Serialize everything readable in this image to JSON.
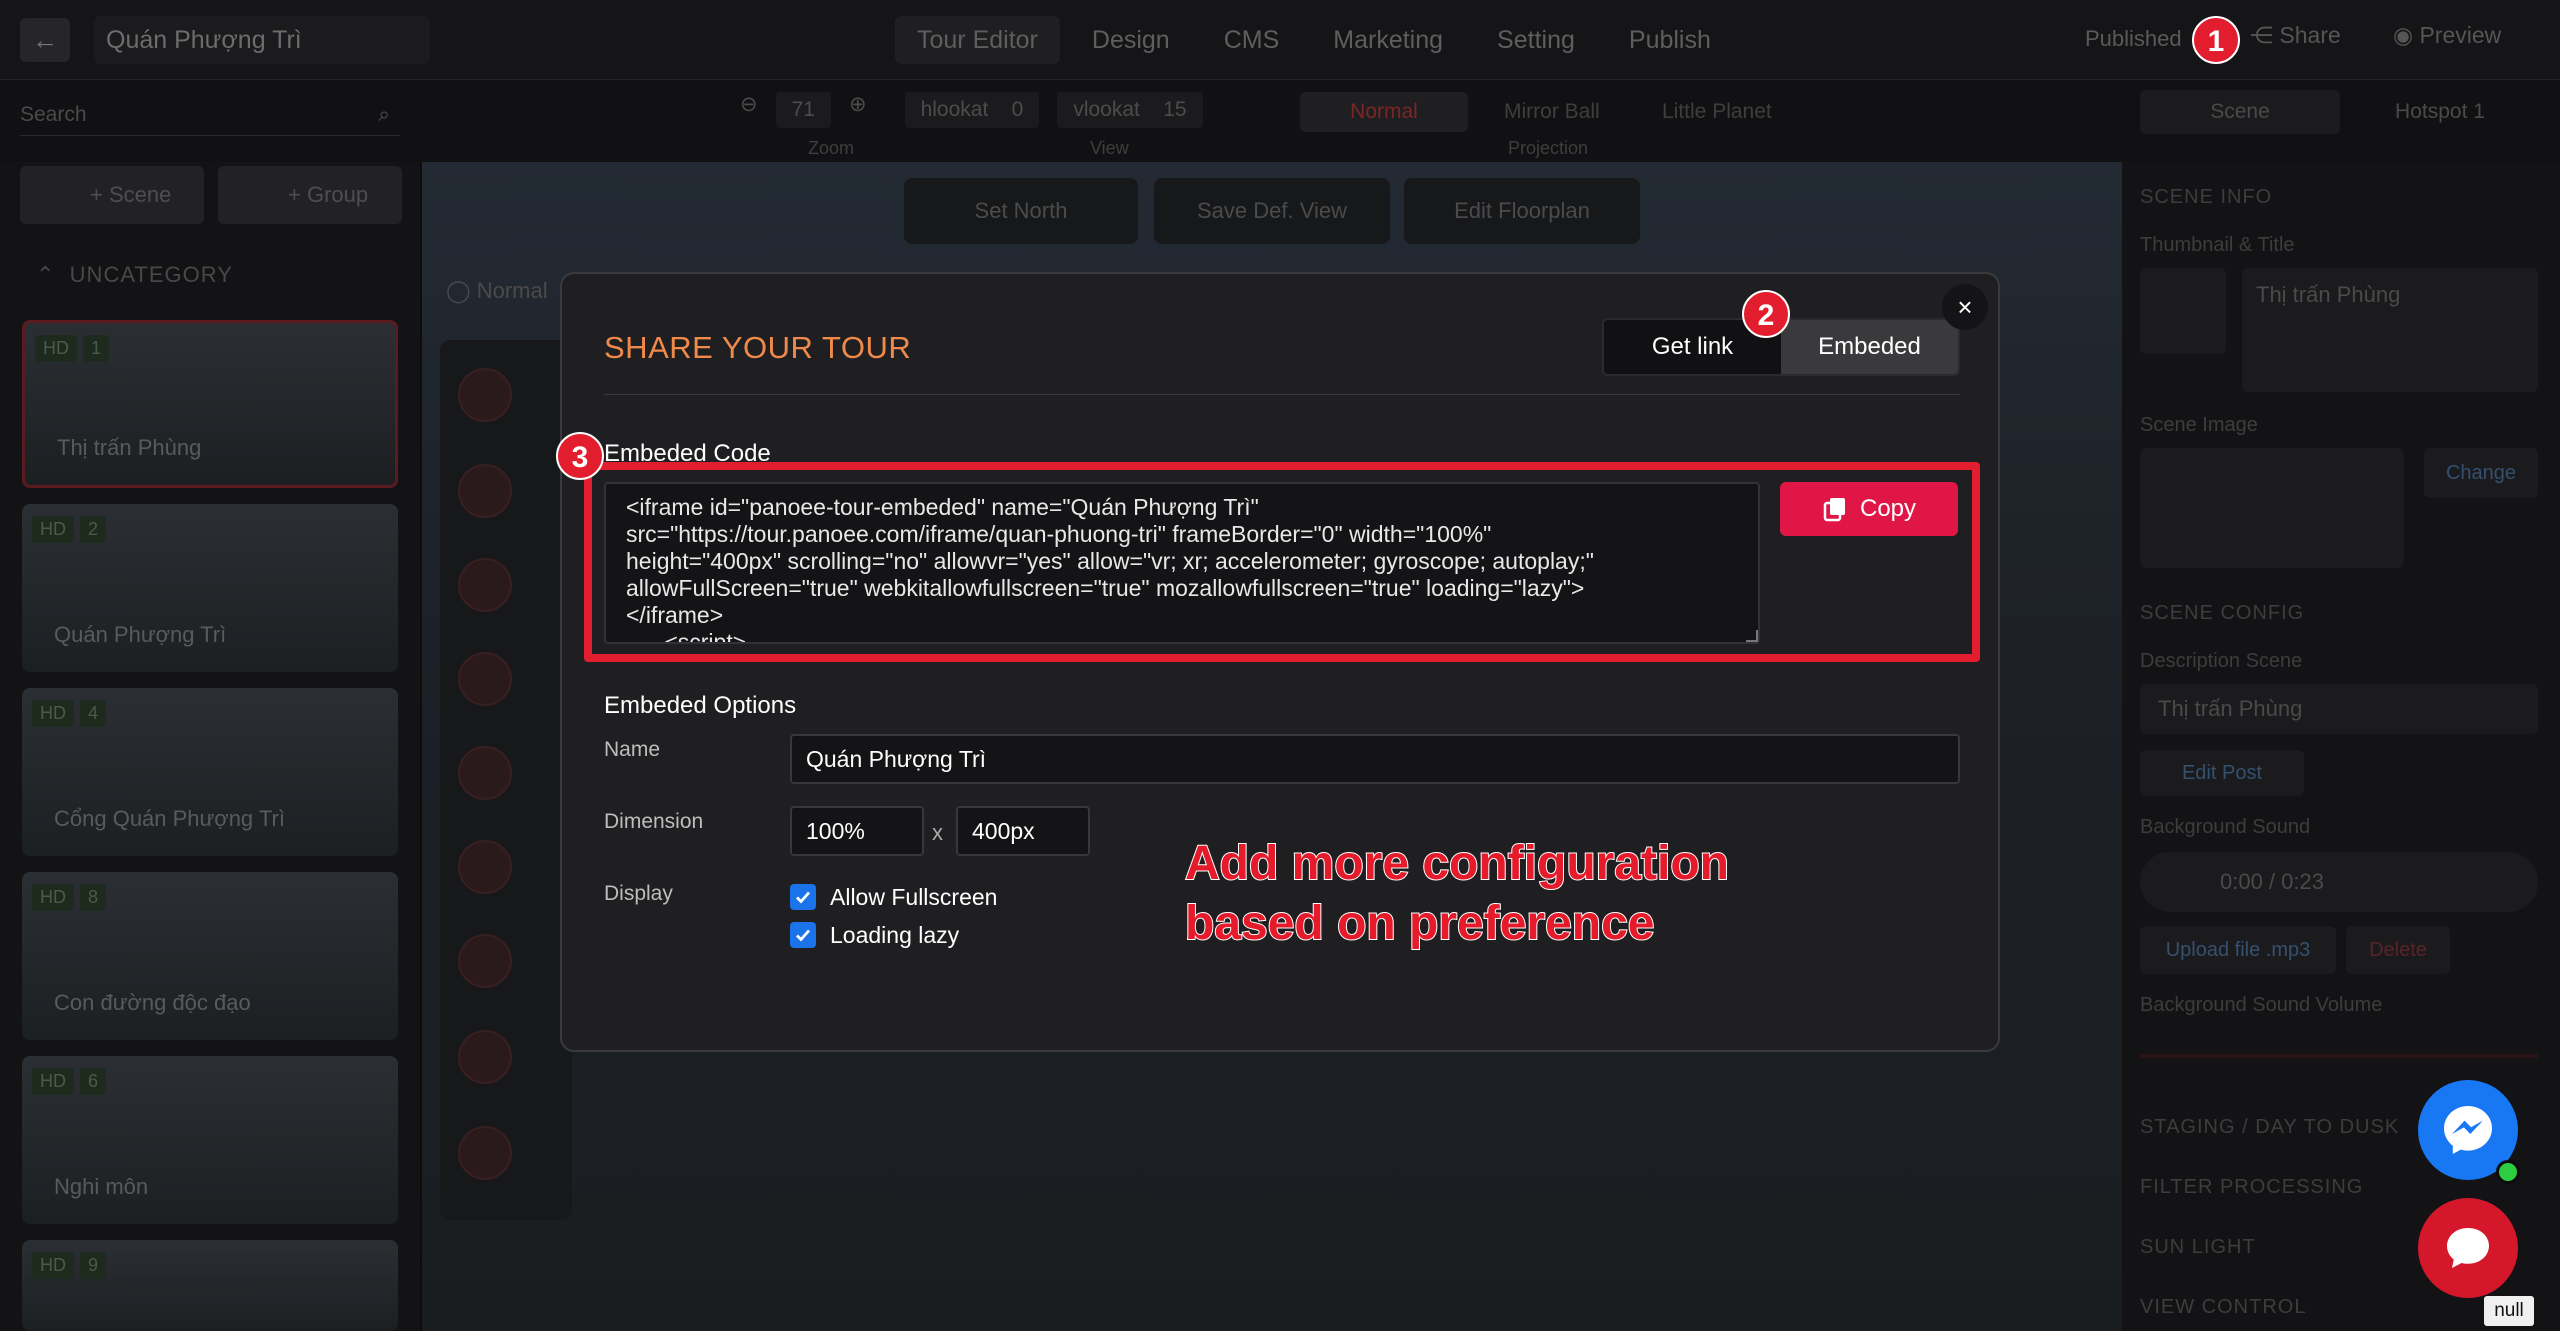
{
  "app": {
    "project_title": "Quán Phượng Trì",
    "nav": [
      "Tour Editor",
      "Design",
      "CMS",
      "Marketing",
      "Setting",
      "Publish"
    ],
    "published_label": "Published",
    "share_label": "Share",
    "preview_label": "Preview",
    "search_placeholder": "Search",
    "zoom_value": "71",
    "zoom_label": "Zoom",
    "hlookat_label": "hlookat",
    "hlookat_value": "0",
    "vlookat_label": "vlookat",
    "vlookat_value": "15",
    "view_label": "View",
    "projection": [
      "Normal",
      "Mirror Ball",
      "Little Planet"
    ],
    "projection_label": "Projection",
    "right_tabs": [
      "Scene",
      "Hotspot"
    ],
    "hotspot_count": "1",
    "add_scene": "+ Scene",
    "add_group": "+ Group",
    "category": "UNCATEGORY",
    "scenes": [
      {
        "name": "Thị trấn Phùng",
        "badge": "HD",
        "num": "1"
      },
      {
        "name": "Quán Phượng Trì",
        "badge": "HD",
        "num": "2"
      },
      {
        "name": "Cổng Quán Phượng Trì",
        "badge": "HD",
        "num": "4"
      },
      {
        "name": "Con đường độc đạo",
        "badge": "HD",
        "num": "8"
      },
      {
        "name": "Nghi môn",
        "badge": "HD",
        "num": "6"
      },
      {
        "name": "",
        "badge": "HD",
        "num": "9"
      }
    ],
    "canvas_buttons": [
      "Set North",
      "Save Def. View",
      "Edit Floorplan"
    ],
    "canvas_mode": "Normal",
    "right_panel": {
      "scene_info": "SCENE INFO",
      "thumb_title": "Thumbnail & Title",
      "scene_title_value": "Thị trấn Phùng",
      "scene_image": "Scene Image",
      "change": "Change",
      "scene_config": "SCENE CONFIG",
      "description_scene": "Description Scene",
      "description_value": "Thị trấn Phùng",
      "edit_post": "Edit Post",
      "background_sound": "Background Sound",
      "audio_time": "0:00 / 0:23",
      "upload_file": "Upload file .mp3",
      "delete": "Delete",
      "bg_volume": "Background Sound Volume",
      "staging": "STAGING / DAY TO DUSK",
      "filter": "FILTER PROCESSING",
      "sun_light": "SUN LIGHT",
      "view_control": "VIEW CONTROL"
    }
  },
  "markers": [
    "1",
    "2",
    "3"
  ],
  "modal": {
    "title": "SHARE YOUR TOUR",
    "tabs": {
      "get_link": "Get link",
      "embeded": "Embeded"
    },
    "close_symbol": "×",
    "embed_code_label": "Embeded Code",
    "embed_code": "<iframe id=\"panoee-tour-embeded\" name=\"Quán Phượng Trì\"\nsrc=\"https://tour.panoee.com/iframe/quan-phuong-tri\" frameBorder=\"0\" width=\"100%\"\nheight=\"400px\" scrolling=\"no\" allowvr=\"yes\" allow=\"vr; xr; accelerometer; gyroscope; autoplay;\"\nallowFullScreen=\"true\" webkitallowfullscreen=\"true\" mozallowfullscreen=\"true\" loading=\"lazy\">\n</iframe>\n      <script>",
    "copy_label": "Copy",
    "options_label": "Embeded Options",
    "name_label": "Name",
    "name_value": "Quán Phượng Trì",
    "dimension_label": "Dimension",
    "width_value": "100%",
    "x_sep": "x",
    "height_value": "400px",
    "display_label": "Display",
    "allow_fullscreen": "Allow Fullscreen",
    "allow_fullscreen_checked": true,
    "loading_lazy": "Loading lazy",
    "loading_lazy_checked": true
  },
  "annotation": {
    "line1": "Add more configuration",
    "line2": "based on preference"
  },
  "widgets": {
    "null_tooltip": "null"
  },
  "colors": {
    "accent_red": "#e01746",
    "marker_red": "#e11d2e",
    "title_orange": "#f08a4b",
    "checkbox_blue": "#1a73e8",
    "messenger_blue": "#1877f2"
  }
}
